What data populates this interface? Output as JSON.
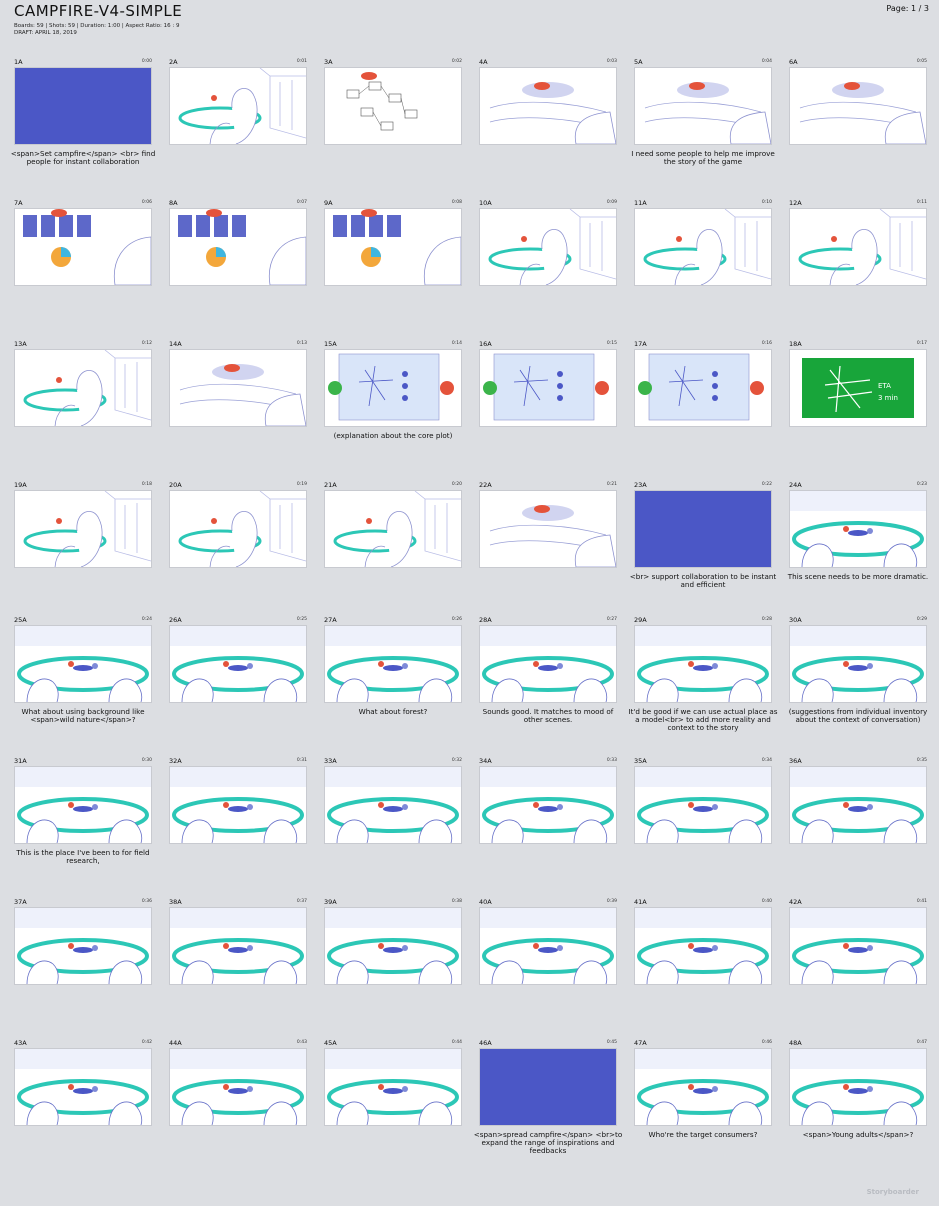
{
  "header": {
    "title": "CAMPFIRE-V4-SIMPLE",
    "meta_line1": "Boards: 59  |  Shots: 59  |  Duration: 1:00  |  Aspect Ratio: 16 : 9",
    "meta_line2": "DRAFT: APRIL 18, 2019",
    "page": "Page: 1 / 3"
  },
  "brand": "Storyboarder",
  "colors": {
    "background": "#dcdee2",
    "blue_fill": "#4b57c6",
    "green_fill": "#18a53a",
    "teal": "#2cc7b6",
    "red": "#e4533b"
  },
  "panels": [
    {
      "num": "1A",
      "time": "0:00",
      "type": "blue",
      "caption": "<span>Set campfire</span> <br> find people for instant collaboration"
    },
    {
      "num": "2A",
      "time": "0:01",
      "type": "room",
      "caption": ""
    },
    {
      "num": "3A",
      "time": "0:02",
      "type": "diagram",
      "caption": ""
    },
    {
      "num": "4A",
      "time": "0:03",
      "type": "sketch",
      "caption": ""
    },
    {
      "num": "5A",
      "time": "0:04",
      "type": "sketch",
      "caption": "I need some people to help me improve the story of the game"
    },
    {
      "num": "6A",
      "time": "0:05",
      "type": "sketch",
      "caption": ""
    },
    {
      "num": "7A",
      "time": "0:06",
      "type": "board",
      "caption": ""
    },
    {
      "num": "8A",
      "time": "0:07",
      "type": "board",
      "caption": ""
    },
    {
      "num": "9A",
      "time": "0:08",
      "type": "board",
      "caption": ""
    },
    {
      "num": "10A",
      "time": "0:09",
      "type": "room",
      "caption": ""
    },
    {
      "num": "11A",
      "time": "0:10",
      "type": "room",
      "caption": ""
    },
    {
      "num": "12A",
      "time": "0:11",
      "type": "room",
      "caption": ""
    },
    {
      "num": "13A",
      "time": "0:12",
      "type": "room",
      "caption": ""
    },
    {
      "num": "14A",
      "time": "0:13",
      "type": "sketch",
      "caption": ""
    },
    {
      "num": "15A",
      "time": "0:14",
      "type": "screen",
      "caption": "(explanation about the core plot)"
    },
    {
      "num": "16A",
      "time": "0:15",
      "type": "screen",
      "caption": ""
    },
    {
      "num": "17A",
      "time": "0:16",
      "type": "screen",
      "caption": ""
    },
    {
      "num": "18A",
      "time": "0:17",
      "type": "green",
      "caption": ""
    },
    {
      "num": "19A",
      "time": "0:18",
      "type": "room",
      "caption": ""
    },
    {
      "num": "20A",
      "time": "0:19",
      "type": "room",
      "caption": ""
    },
    {
      "num": "21A",
      "time": "0:20",
      "type": "room",
      "caption": ""
    },
    {
      "num": "22A",
      "time": "0:21",
      "type": "sketch",
      "caption": ""
    },
    {
      "num": "23A",
      "time": "0:22",
      "type": "blue",
      "caption": "<br> support collaboration to be instant and efficient"
    },
    {
      "num": "24A",
      "time": "0:23",
      "type": "table",
      "caption": "This scene needs to be more dramatic."
    },
    {
      "num": "25A",
      "time": "0:24",
      "type": "table",
      "caption": "What about using background like <span>wild nature</span>?"
    },
    {
      "num": "26A",
      "time": "0:25",
      "type": "table",
      "caption": ""
    },
    {
      "num": "27A",
      "time": "0:26",
      "type": "table",
      "caption": "What about forest?"
    },
    {
      "num": "28A",
      "time": "0:27",
      "type": "table",
      "caption": "Sounds good. It matches to mood of other scenes."
    },
    {
      "num": "29A",
      "time": "0:28",
      "type": "table",
      "caption": "It'd be good if we can use actual place as a model<br> to add more reality and context to the story"
    },
    {
      "num": "30A",
      "time": "0:29",
      "type": "table",
      "caption": "(suggestions from individual inventory about the context of conversation)"
    },
    {
      "num": "31A",
      "time": "0:30",
      "type": "table",
      "caption": "This is the place I've been to for field research,"
    },
    {
      "num": "32A",
      "time": "0:31",
      "type": "table",
      "caption": ""
    },
    {
      "num": "33A",
      "time": "0:32",
      "type": "table",
      "caption": ""
    },
    {
      "num": "34A",
      "time": "0:33",
      "type": "table",
      "caption": ""
    },
    {
      "num": "35A",
      "time": "0:34",
      "type": "table",
      "caption": ""
    },
    {
      "num": "36A",
      "time": "0:35",
      "type": "table",
      "caption": ""
    },
    {
      "num": "37A",
      "time": "0:36",
      "type": "table",
      "caption": ""
    },
    {
      "num": "38A",
      "time": "0:37",
      "type": "table",
      "caption": ""
    },
    {
      "num": "39A",
      "time": "0:38",
      "type": "table",
      "caption": ""
    },
    {
      "num": "40A",
      "time": "0:39",
      "type": "table",
      "caption": ""
    },
    {
      "num": "41A",
      "time": "0:40",
      "type": "table",
      "caption": ""
    },
    {
      "num": "42A",
      "time": "0:41",
      "type": "table",
      "caption": ""
    },
    {
      "num": "43A",
      "time": "0:42",
      "type": "table",
      "caption": ""
    },
    {
      "num": "44A",
      "time": "0:43",
      "type": "table",
      "caption": ""
    },
    {
      "num": "45A",
      "time": "0:44",
      "type": "table",
      "caption": ""
    },
    {
      "num": "46A",
      "time": "0:45",
      "type": "blue",
      "caption": "<span>spread campfire</span> <br>to expand the range of inspirations and feedbacks"
    },
    {
      "num": "47A",
      "time": "0:46",
      "type": "table",
      "caption": "Who're the target consumers?"
    },
    {
      "num": "48A",
      "time": "0:47",
      "type": "table",
      "caption": "<span>Young adults</span>?"
    }
  ]
}
